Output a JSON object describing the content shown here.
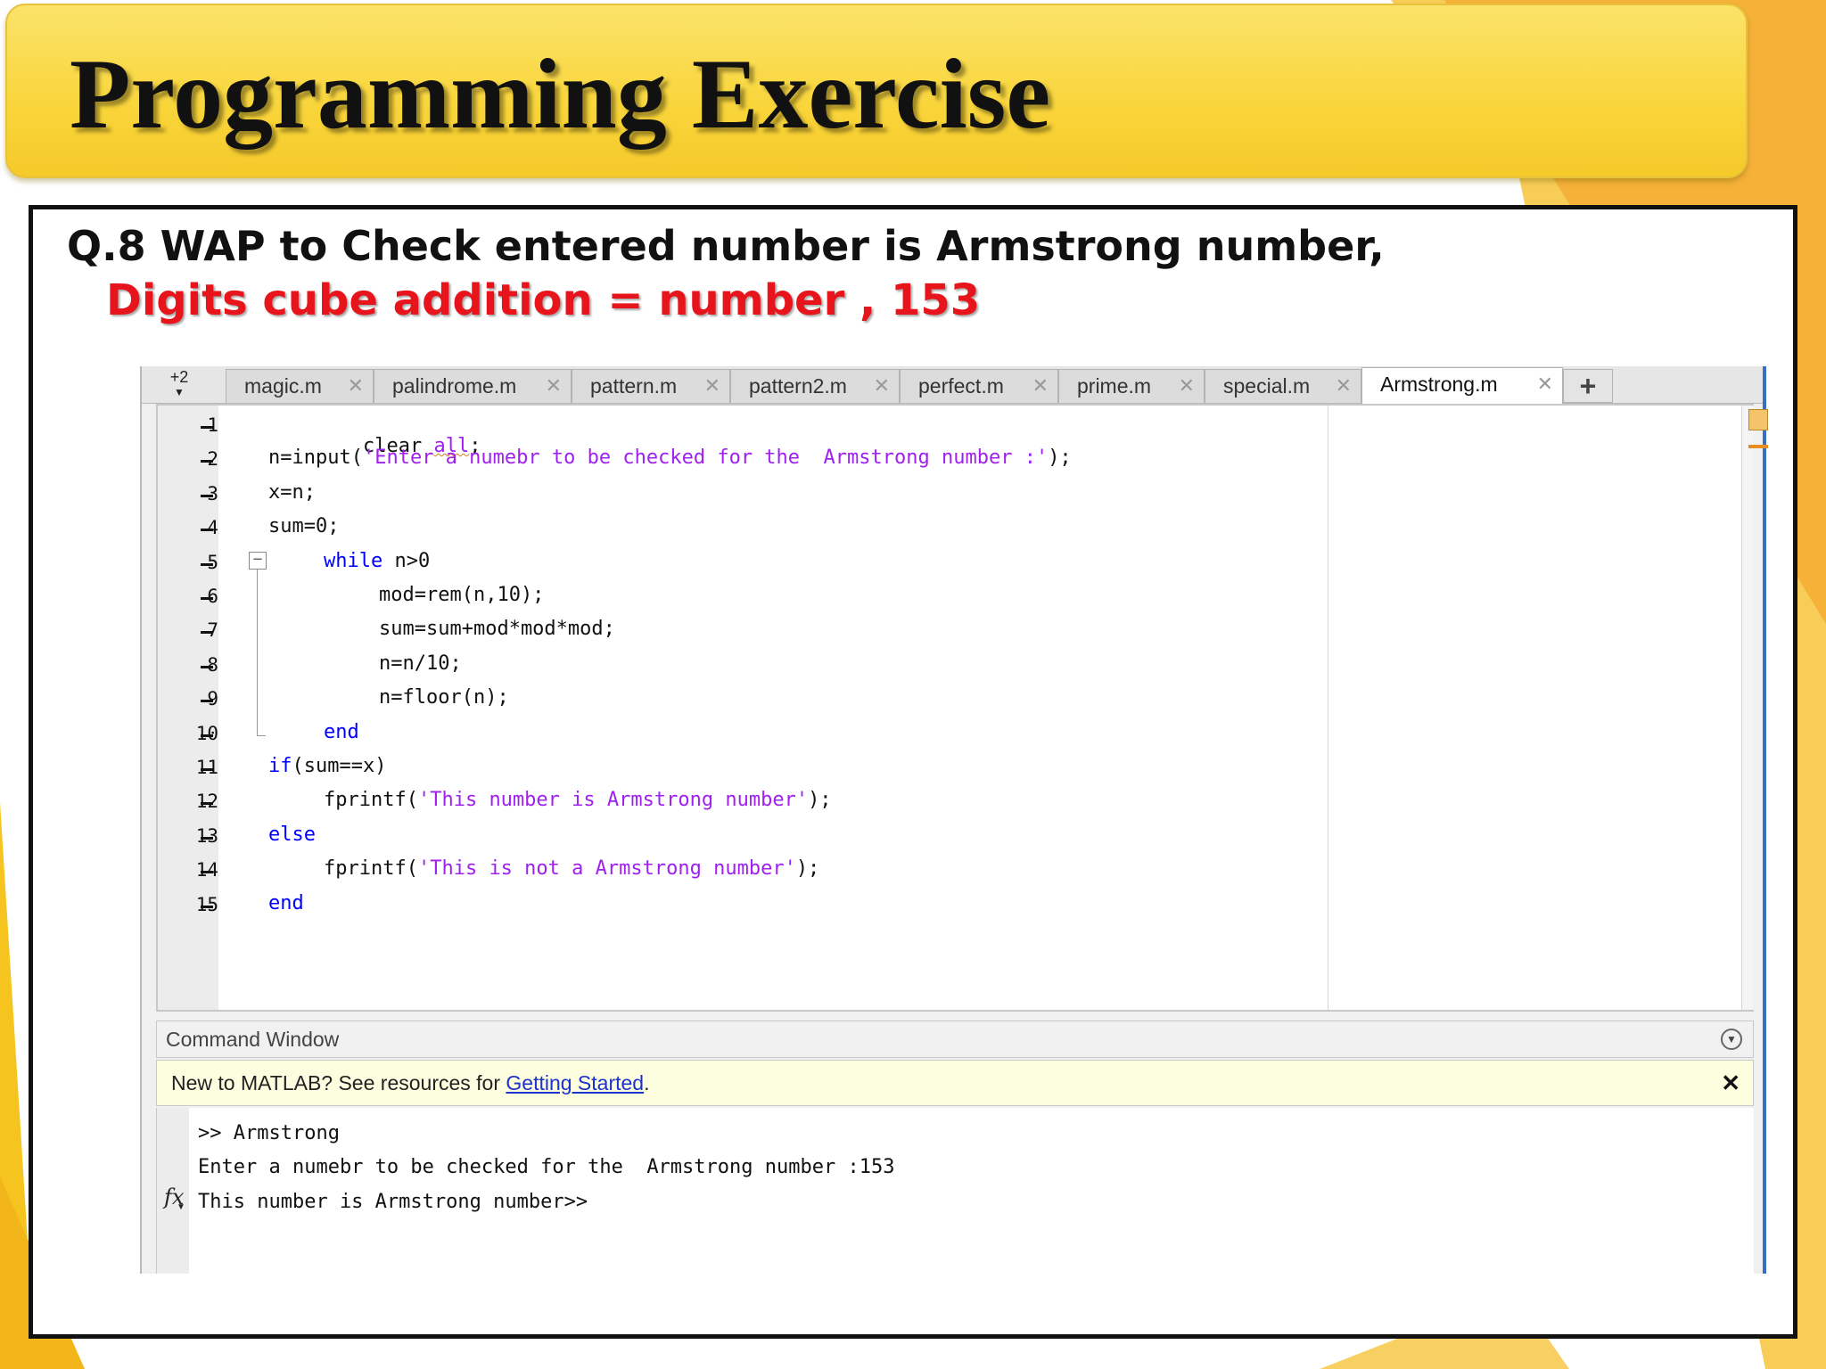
{
  "slide": {
    "title": "Programming Exercise",
    "question": "Q.8  WAP to Check entered number is Armstrong number,",
    "subtitle": "Digits cube addition = number , 153"
  },
  "editor": {
    "tab_overflow": "+2",
    "tabs": [
      {
        "label": "magic.m",
        "active": false
      },
      {
        "label": "palindrome.m",
        "active": false
      },
      {
        "label": "pattern.m",
        "active": false
      },
      {
        "label": "pattern2.m",
        "active": false
      },
      {
        "label": "perfect.m",
        "active": false
      },
      {
        "label": "prime.m",
        "active": false
      },
      {
        "label": "special.m",
        "active": false
      },
      {
        "label": "Armstrong.m",
        "active": true
      }
    ],
    "tab_add": "+",
    "tab_close": "✕",
    "line_numbers": [
      "1",
      "2",
      "3",
      "4",
      "5",
      "6",
      "7",
      "8",
      "9",
      "10",
      "11",
      "12",
      "13",
      "14",
      "15"
    ],
    "code": [
      "clear all;",
      "n=input('Enter a numebr to be checked for the  Armstrong number :');",
      "x=n;",
      "sum=0;",
      "while n>0",
      "mod=rem(n,10);",
      "sum=sum+mod*mod*mod;",
      "n=n/10;",
      "n=floor(n);",
      "end",
      "if(sum==x)",
      "fprintf('This number is Armstrong number');",
      "else",
      "fprintf('This is not a Armstrong number');",
      "end"
    ]
  },
  "command_window": {
    "title": "Command Window",
    "notice_prefix": "New to MATLAB? See resources for ",
    "notice_link": "Getting Started",
    "notice_suffix": ".",
    "notice_close": "✕",
    "fx_label": "fx",
    "lines": [
      ">> Armstrong",
      "Enter a numebr to be checked for the  Armstrong number :153",
      "This number is Armstrong number>>"
    ]
  },
  "colors": {
    "title_banner": "#f9d53a",
    "subtitle_red": "#e8141b",
    "keyword_blue": "#0000ff",
    "string_purple": "#a020f0"
  }
}
